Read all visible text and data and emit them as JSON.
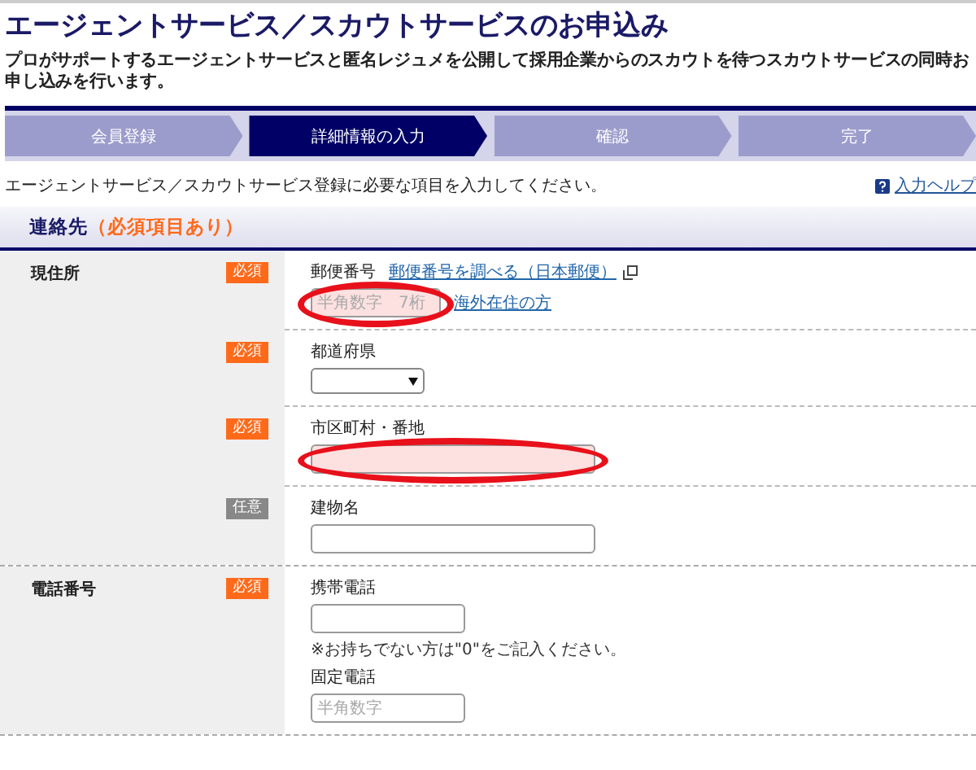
{
  "title": "エージェントサービス／スカウトサービスのお申込み",
  "description": "プロがサポートするエージェントサービスと匿名レジュメを公開して採用企業からのスカウトを待つスカウトサービスの同時お申し込みを行います。",
  "steps": [
    {
      "label": "会員登録",
      "selected": false
    },
    {
      "label": "詳細情報の入力",
      "selected": true
    },
    {
      "label": "確認",
      "selected": false
    },
    {
      "label": "完了",
      "selected": false
    }
  ],
  "intro": "エージェントサービス／スカウトサービス登録に必要な項目を入力してください。",
  "help_link": "入力ヘルプ",
  "section": {
    "title": "連絡先",
    "note": "（必須項目あり）"
  },
  "groups": [
    {
      "label": "現住所",
      "rows": [
        {
          "badge": {
            "kind": "required",
            "text": "必須"
          },
          "lines": [
            [
              {
                "kind": "label",
                "text": "郵便番号"
              },
              {
                "kind": "link",
                "text": "郵便番号を調べる（日本郵便）",
                "external": true
              }
            ],
            [
              {
                "kind": "short-input",
                "placeholder": "半角数字　7桁",
                "highlighted": true
              },
              {
                "kind": "link",
                "text": "海外在住の方"
              }
            ]
          ]
        },
        {
          "badge": {
            "kind": "required",
            "text": "必須"
          },
          "lines": [
            [
              {
                "kind": "label",
                "text": "都道府県"
              }
            ],
            [
              {
                "kind": "select"
              }
            ]
          ]
        },
        {
          "badge": {
            "kind": "required",
            "text": "必須"
          },
          "lines": [
            [
              {
                "kind": "label",
                "text": "市区町村・番地"
              }
            ],
            [
              {
                "kind": "long-input",
                "highlighted": true
              }
            ]
          ]
        },
        {
          "badge": {
            "kind": "optional",
            "text": "任意"
          },
          "lines": [
            [
              {
                "kind": "label",
                "text": "建物名"
              }
            ],
            [
              {
                "kind": "long-input",
                "highlighted": false
              }
            ]
          ]
        }
      ]
    },
    {
      "label": "電話番号",
      "rows": [
        {
          "badge": {
            "kind": "required",
            "text": "必須"
          },
          "lines": [
            [
              {
                "kind": "label",
                "text": "携帯電話"
              }
            ],
            [
              {
                "kind": "input",
                "highlighted": false
              }
            ],
            [
              {
                "kind": "note",
                "text": "※お持ちでない方は\"0\"をご記入ください。"
              }
            ],
            [
              {
                "kind": "label",
                "text": "固定電話"
              }
            ],
            [
              {
                "kind": "input",
                "placeholder": "半角数字",
                "highlighted": false
              }
            ]
          ]
        }
      ]
    }
  ]
}
